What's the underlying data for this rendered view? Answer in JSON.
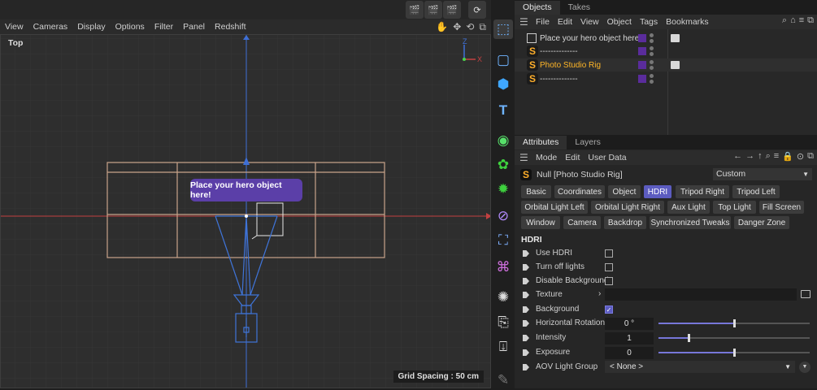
{
  "top_toolbar": {
    "icons": [
      "clapper-render-icon",
      "clapper-edit-icon",
      "clapper-settings-icon",
      "refresh-icon"
    ]
  },
  "viewport_menu": {
    "items": [
      "View",
      "Cameras",
      "Display",
      "Options",
      "Filter",
      "Panel",
      "Redshift"
    ]
  },
  "viewport": {
    "label": "Top",
    "tooltip": "Place your hero object here!",
    "grid_spacing": "Grid Spacing : 50 cm",
    "axis_labels": {
      "z": "Z",
      "x": "X"
    }
  },
  "objects_panel": {
    "tabs": [
      "Objects",
      "Takes"
    ],
    "active_tab": "Objects",
    "menu": [
      "File",
      "Edit",
      "View",
      "Object",
      "Tags",
      "Bookmarks"
    ],
    "rows": [
      {
        "name": "Place your hero object here!",
        "icon": "null-object-icon",
        "has_tag": true,
        "highlight": false
      },
      {
        "name": "--------------",
        "icon": "s-object-icon",
        "has_tag": false,
        "highlight": false
      },
      {
        "name": "Photo Studio Rig",
        "icon": "s-object-icon",
        "has_tag": true,
        "highlight": true
      },
      {
        "name": "--------------",
        "icon": "s-object-icon",
        "has_tag": false,
        "highlight": false
      }
    ],
    "colors": {
      "selected_name": "#ffb627",
      "layer_swatch": "#5a2c9c"
    }
  },
  "attributes_panel": {
    "tabs": [
      "Attributes",
      "Layers"
    ],
    "active_tab": "Attributes",
    "menu": [
      "Mode",
      "Edit",
      "User Data"
    ],
    "object_name": "Null [Photo Studio Rig]",
    "preset": "Custom",
    "section_tabs": [
      [
        "Basic",
        "Coordinates",
        "Object",
        "HDRI",
        "Tripod Right",
        "Tripod Left"
      ],
      [
        "Orbital Light Left",
        "Orbital Light Right",
        "Aux Light",
        "Top Light",
        "Fill Screen"
      ],
      [
        "Window",
        "Camera",
        "Backdrop",
        "Synchronized Tweaks",
        "Danger Zone"
      ]
    ],
    "active_section": "HDRI",
    "section_title": "HDRI",
    "params": {
      "use_hdri": {
        "label": "Use HDRI",
        "checked": false
      },
      "turn_off_lights": {
        "label": "Turn off lights",
        "checked": false
      },
      "disable_background": {
        "label": "Disable Background",
        "checked": false
      },
      "texture": {
        "label": "Texture",
        "value": ""
      },
      "background": {
        "label": "Background",
        "checked": true
      },
      "horizontal_rotation": {
        "label": "Horizontal Rotation",
        "value": "0 °",
        "slider": 0.5
      },
      "intensity": {
        "label": "Intensity",
        "value": "1",
        "slider": 0.2
      },
      "exposure": {
        "label": "Exposure",
        "value": "0",
        "slider": 0.5
      },
      "aov_light_group": {
        "label": "AOV Light Group",
        "value": "< None >"
      }
    },
    "colors": {
      "accent": "#5c5cc0"
    }
  },
  "tool_column": {
    "icons": [
      "move-tool-icon",
      "cube-outline-icon",
      "cube-icon",
      "text-icon",
      "spline-pen-icon",
      "mograph-cloner-icon",
      "generator-icon",
      "deformer-icon",
      "field-icon",
      "scene-icon",
      "light-icon",
      "camera-icon",
      "render-tag-icon",
      "edit-pen-icon"
    ]
  }
}
